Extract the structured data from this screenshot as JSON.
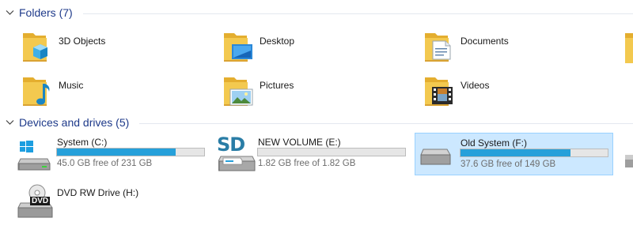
{
  "folders_group": {
    "title": "Folders (7)"
  },
  "folders": [
    {
      "name": "3D Objects",
      "icon": "folder-3d-objects-icon"
    },
    {
      "name": "Desktop",
      "icon": "folder-desktop-icon"
    },
    {
      "name": "Documents",
      "icon": "folder-documents-icon"
    },
    {
      "name": "Music",
      "icon": "folder-music-icon"
    },
    {
      "name": "Pictures",
      "icon": "folder-pictures-icon"
    },
    {
      "name": "Videos",
      "icon": "folder-videos-icon"
    }
  ],
  "devices_group": {
    "title": "Devices and drives (5)"
  },
  "drives": [
    {
      "name": "System (C:)",
      "free_text": "45.0 GB free of 231 GB",
      "used_fraction": 0.805,
      "icon": "windows-system-drive-icon",
      "selected": false
    },
    {
      "name": "NEW VOLUME (E:)",
      "free_text": "1.82 GB free of 1.82 GB",
      "used_fraction": 0.0,
      "icon": "sd-card-icon",
      "selected": false
    },
    {
      "name": "Old System (F:)",
      "free_text": "37.6 GB free of 149 GB",
      "used_fraction": 0.748,
      "icon": "hard-drive-icon",
      "selected": true
    },
    {
      "name": "DVD RW Drive (H:)",
      "icon": "dvd-drive-icon",
      "selected": false
    }
  ],
  "sd_icon_text": "SD",
  "dvd_icon_text": "DVD",
  "colors": {
    "accent": "#26a0da",
    "header": "#1e3a8a",
    "selection": "#cce8ff",
    "selection_border": "#99d1ff",
    "folder": "#f3c94f"
  }
}
